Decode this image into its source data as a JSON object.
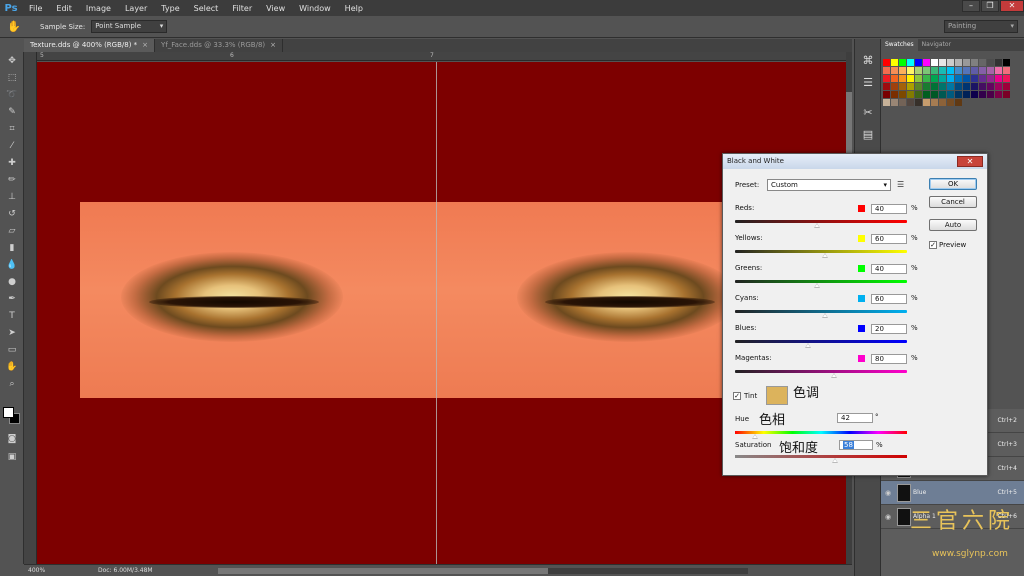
{
  "app": {
    "logo": "Ps"
  },
  "menu": [
    "File",
    "Edit",
    "Image",
    "Layer",
    "Type",
    "Select",
    "Filter",
    "View",
    "Window",
    "Help"
  ],
  "window_controls": [
    "–",
    "❐",
    "✕"
  ],
  "options": {
    "sample_size_label": "Sample Size:",
    "sample_size_value": "Point Sample",
    "workspace": "Painting"
  },
  "tabs": [
    {
      "label": "Texture.dds @ 400% (RGB/8) *",
      "close": "×"
    },
    {
      "label": "Yf_Face.dds @ 33.3% (RGB/8)",
      "close": "×"
    }
  ],
  "ruler": {
    "left_num": "5",
    "mid_num": "6",
    "right_num": "7"
  },
  "status": {
    "zoom": "400%",
    "doc": "Doc: 6.00M/3.48M"
  },
  "panel": {
    "tabs": [
      "Swatches",
      "Navigator"
    ],
    "swatch_colors": [
      "#ff0000",
      "#ffff00",
      "#00ff00",
      "#00ffff",
      "#0000ff",
      "#ff00ff",
      "#ffffff",
      "#e6e6e6",
      "#cccccc",
      "#b3b3b3",
      "#999999",
      "#808080",
      "#666666",
      "#4d4d4d",
      "#333333",
      "#000000",
      "#f26c4f",
      "#f68e56",
      "#fbaf5c",
      "#fff467",
      "#acd372",
      "#7cc576",
      "#3bb878",
      "#1abbb4",
      "#00bff3",
      "#438ccb",
      "#5574b9",
      "#605ca8",
      "#855fa8",
      "#a763a9",
      "#f06ea9",
      "#f26d7d",
      "#ed1c24",
      "#f26522",
      "#f7941d",
      "#fff200",
      "#8dc63f",
      "#39b54a",
      "#00a651",
      "#00a99d",
      "#00aeef",
      "#0072bc",
      "#0054a6",
      "#2e3192",
      "#662d91",
      "#92278f",
      "#ec008c",
      "#ed145b",
      "#9e0b0f",
      "#a0410d",
      "#a3620a",
      "#aba000",
      "#598527",
      "#1a7b30",
      "#007236",
      "#00746b",
      "#0076a3",
      "#004a80",
      "#003471",
      "#1b1464",
      "#440e62",
      "#630460",
      "#9e005d",
      "#9e0039",
      "#790000",
      "#7b2e00",
      "#7d4900",
      "#827b00",
      "#406618",
      "#005e20",
      "#005826",
      "#005952",
      "#005b7f",
      "#003663",
      "#002157",
      "#0d004c",
      "#32004b",
      "#4b0049",
      "#7b0046",
      "#7a0026",
      "#c7b299",
      "#998675",
      "#736357",
      "#534741",
      "#37302a",
      "#c69c6d",
      "#a67c52",
      "#8c6239",
      "#754c24",
      "#603913"
    ],
    "layers": [
      {
        "name": "",
        "key": "Ctrl+2"
      },
      {
        "name": "",
        "key": "Ctrl+3"
      },
      {
        "name": "",
        "key": "Ctrl+4"
      },
      {
        "name": "Blue",
        "key": "Ctrl+5"
      },
      {
        "name": "Alpha 1",
        "key": "Ctrl+6"
      }
    ]
  },
  "watermark": {
    "text": "三官六院",
    "url": "www.sglynp.com"
  },
  "dialog": {
    "title": "Black and White",
    "close": "✕",
    "preset_label": "Preset:",
    "preset_value": "Custom",
    "ok": "OK",
    "cancel": "Cancel",
    "auto": "Auto",
    "preview_label": "Preview",
    "preview_checked": "✓",
    "sliders": [
      {
        "label": "Reds:",
        "value": "40",
        "pct": "%",
        "color": "#ff0000",
        "track": "linear-gradient(90deg,#222,#ff0000)",
        "pos": 0.475
      },
      {
        "label": "Yellows:",
        "value": "60",
        "pct": "%",
        "color": "#ffff00",
        "track": "linear-gradient(90deg,#222,#ffff00)",
        "pos": 0.525
      },
      {
        "label": "Greens:",
        "value": "40",
        "pct": "%",
        "color": "#00ff00",
        "track": "linear-gradient(90deg,#222,#00ff00)",
        "pos": 0.475
      },
      {
        "label": "Cyans:",
        "value": "60",
        "pct": "%",
        "color": "#00b0f0",
        "track": "linear-gradient(90deg,#222,#00b0f0)",
        "pos": 0.525
      },
      {
        "label": "Blues:",
        "value": "20",
        "pct": "%",
        "color": "#0000ff",
        "track": "linear-gradient(90deg,#222,#0000ff)",
        "pos": 0.425
      },
      {
        "label": "Magentas:",
        "value": "80",
        "pct": "%",
        "color": "#ff00cc",
        "track": "linear-gradient(90deg,#222,#ff00cc)",
        "pos": 0.575
      }
    ],
    "tint_label": "Tint",
    "tint_checked": "✓",
    "tint_color": "#dcb35c",
    "anno_tint": "色调",
    "hue_label": "Hue",
    "anno_hue": "色相",
    "hue_value": "42",
    "hue_unit": "°",
    "hue_pos": 0.117,
    "sat_label": "Saturation",
    "anno_sat": "饱和度",
    "sat_value": "58",
    "sat_unit": "%",
    "sat_pos": 0.58
  }
}
